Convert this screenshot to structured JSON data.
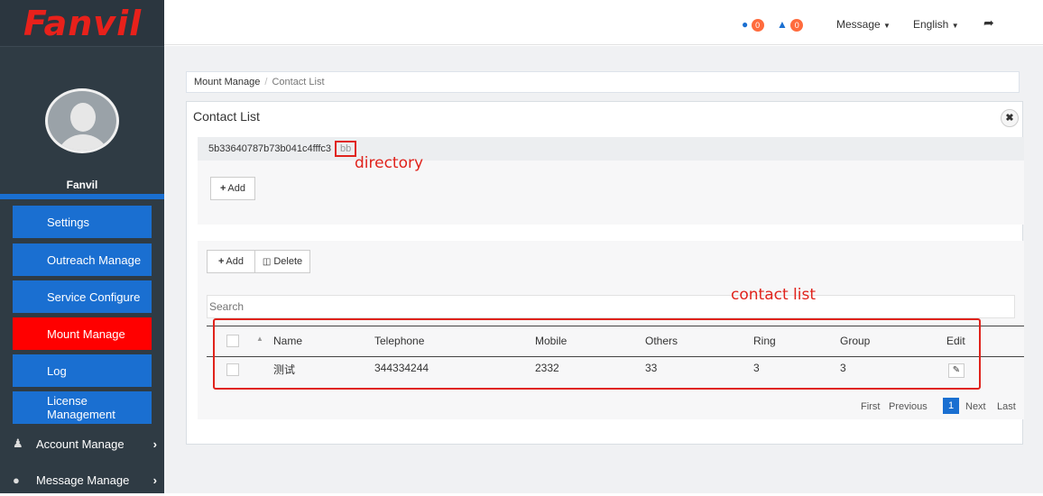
{
  "app": {
    "logo": "Fanvil"
  },
  "profile": {
    "name": "Fanvil"
  },
  "sidebar": {
    "items": [
      {
        "label": "Settings"
      },
      {
        "label": "Outreach Manage"
      },
      {
        "label": "Service Configure"
      },
      {
        "label": "Mount Manage"
      },
      {
        "label": "Log"
      },
      {
        "label": "License Management"
      },
      {
        "label": "Account Manage"
      },
      {
        "label": "Message Manage"
      }
    ]
  },
  "topbar": {
    "comments_count": "0",
    "alerts_count": "0",
    "message_label": "Message",
    "language_label": "English"
  },
  "breadcrumb": {
    "parent": "Mount Manage",
    "separator": "/",
    "current": "Contact List"
  },
  "panel": {
    "title": "Contact List",
    "close": "✖"
  },
  "directory": {
    "path_id": "5b33640787b73b041c4fffc3",
    "current": "bb",
    "annotation": "directory",
    "add_label": "Add"
  },
  "contacts": {
    "add_label": "Add",
    "delete_label": "Delete",
    "search_placeholder": "Search",
    "annotation": "contact list",
    "columns": [
      "Name",
      "Telephone",
      "Mobile",
      "Others",
      "Ring",
      "Group",
      "Edit"
    ],
    "rows": [
      {
        "name": "测试",
        "telephone": "344334244",
        "mobile": "2332",
        "others": "33",
        "ring": "3",
        "group": "3"
      }
    ]
  },
  "pagination": {
    "first": "First",
    "previous": "Previous",
    "current": "1",
    "next": "Next",
    "last": "Last"
  },
  "colors": {
    "sidebar": "#2f3b44",
    "menu_blue": "#1a6fd1",
    "active_red": "#ff0000",
    "annotation_red": "#e0231c"
  }
}
